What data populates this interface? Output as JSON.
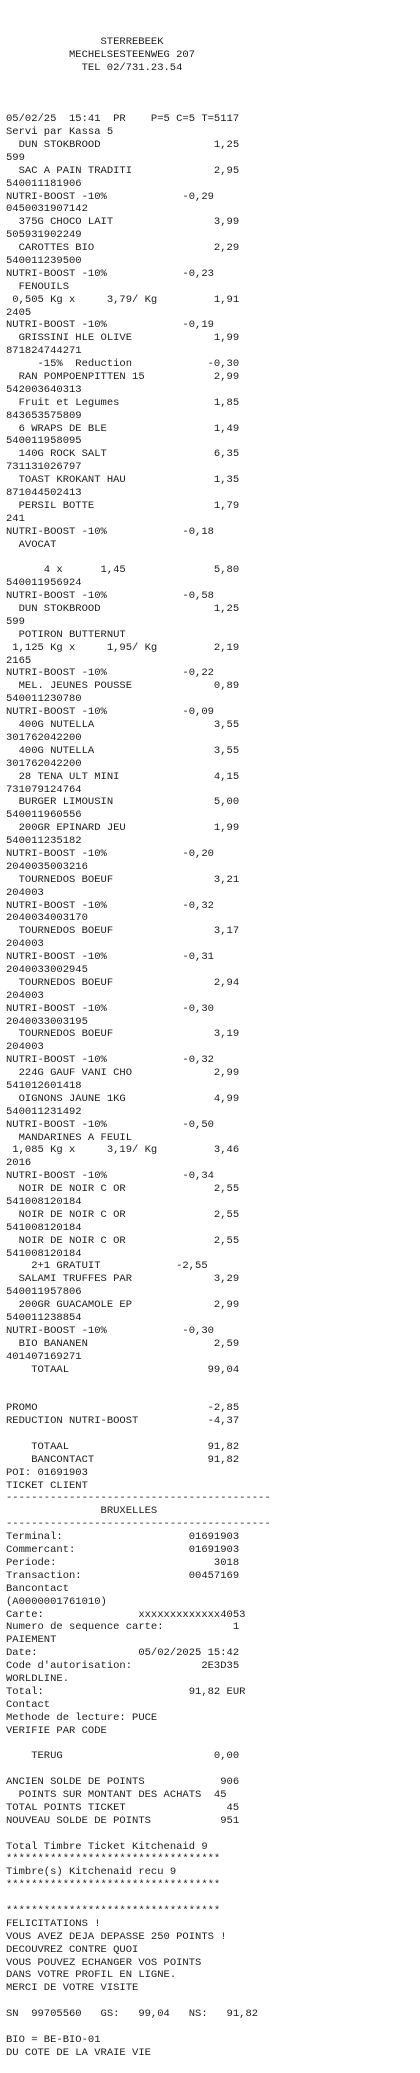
{
  "header": [
    "STERREBEEK",
    "MECHELSESTEENWEG 207",
    "TEL 02/731.23.54"
  ],
  "lines": [
    "",
    "05/02/25  15:41  PR    P=5 C=5 T=5117",
    "Servi par Kassa 5",
    "  DUN STOKBROOD                  1,25",
    "599",
    "  SAC A PAIN TRADITI             2,95",
    "540011181906",
    "NUTRI-BOOST -10%            -0,29",
    "0450031907142",
    "  375G CHOCO LAIT                3,99",
    "505931902249",
    "  CAROTTES BIO                   2,29",
    "540011239500",
    "NUTRI-BOOST -10%            -0,23",
    "  FENOUILS",
    " 0,505 Kg x     3,79/ Kg         1,91",
    "2405",
    "NUTRI-BOOST -10%            -0,19",
    "  GRISSINI HLE OLIVE             1,99",
    "871824744271",
    "     -15%  Reduction            -0,30",
    "  RAN POMPOENPITTEN 15           2,99",
    "542003640313",
    "  Fruit et Legumes               1,85",
    "843653575809",
    "  6 WRAPS DE BLE                 1,49",
    "540011958095",
    "  140G ROCK SALT                 6,35",
    "731131026797",
    "  TOAST KROKANT HAU              1,35",
    "871044502413",
    "  PERSIL BOTTE                   1,79",
    "241",
    "NUTRI-BOOST -10%            -0,18",
    "  AVOCAT",
    "",
    "      4 x      1,45              5,80",
    "540011956924",
    "NUTRI-BOOST -10%            -0,58",
    "  DUN STOKBROOD                  1,25",
    "599",
    "  POTIRON BUTTERNUT",
    " 1,125 Kg x     1,95/ Kg         2,19",
    "2165",
    "NUTRI-BOOST -10%            -0,22",
    "  MEL. JEUNES POUSSE             0,89",
    "540011230780",
    "NUTRI-BOOST -10%            -0,09",
    "  400G NUTELLA                   3,55",
    "301762042200",
    "  400G NUTELLA                   3,55",
    "301762042200",
    "  28 TENA ULT MINI               4,15",
    "731079124764",
    "  BURGER LIMOUSIN                5,00",
    "540011960556",
    "  200GR EPINARD JEU              1,99",
    "540011235182",
    "NUTRI-BOOST -10%            -0,20",
    "2040035003216",
    "  TOURNEDOS BOEUF                3,21",
    "204003",
    "NUTRI-BOOST -10%            -0,32",
    "2040034003170",
    "  TOURNEDOS BOEUF                3,17",
    "204003",
    "NUTRI-BOOST -10%            -0,31",
    "2040033002945",
    "  TOURNEDOS BOEUF                2,94",
    "204003",
    "NUTRI-BOOST -10%            -0,30",
    "2040033003195",
    "  TOURNEDOS BOEUF                3,19",
    "204003",
    "NUTRI-BOOST -10%            -0,32",
    "  224G GAUF VANI CHO             2,99",
    "541012601418",
    "  OIGNONS JAUNE 1KG              4,99",
    "540011231492",
    "NUTRI-BOOST -10%            -0,50",
    "  MANDARINES A FEUIL",
    " 1,085 Kg x     3,19/ Kg         3,46",
    "2016",
    "NUTRI-BOOST -10%            -0,34",
    "  NOIR DE NOIR C OR              2,55",
    "541008120184",
    "  NOIR DE NOIR C OR              2,55",
    "541008120184",
    "  NOIR DE NOIR C OR              2,55",
    "541008120184",
    "    2+1 GRATUIT            -2,55",
    "  SALAMI TRUFFES PAR             3,29",
    "540011957806",
    "  200GR GUACAMOLE EP             2,99",
    "540011238854",
    "NUTRI-BOOST -10%            -0,30",
    "  BIO BANANEN                    2,59",
    "401407169271",
    "    TOTAAL                      99,04",
    "",
    "",
    "PROMO                           -2,85",
    "REDUCTION NUTRI-BOOST           -4,37",
    "",
    "    TOTAAL                      91,82",
    "    BANCONTACT                  91,82",
    "POI: 01691903",
    "TICKET CLIENT",
    "------------------------------------------",
    "               BRUXELLES",
    "------------------------------------------",
    "Terminal:                    01691903",
    "Commercant:                  01691903",
    "Periode:                         3018",
    "Transaction:                 00457169",
    "Bancontact",
    "(A0000001761010)",
    "Carte:               xxxxxxxxxxxxx4053",
    "Numero de sequence carte:           1",
    "PAIEMENT",
    "Date:                05/02/2025 15:42",
    "Code d'autorisation:           2E3D35",
    "WORLDLINE.",
    "Total:                       91,82 EUR",
    "Contact",
    "Methode de lecture: PUCE",
    "VERIFIE PAR CODE",
    "",
    "    TERUG                        0,00",
    "",
    "ANCIEN SOLDE DE POINTS            906",
    "  POINTS SUR MONTANT DES ACHATS  45",
    "TOTAL POINTS TICKET                45",
    "NOUVEAU SOLDE DE POINTS           951",
    "",
    "Total Timbre Ticket Kitchenaid 9",
    "**********************************",
    "Timbre(s) Kitchenaid recu 9",
    "**********************************",
    "",
    "**********************************",
    "FELICITATIONS !",
    "VOUS AVEZ DEJA DEPASSE 250 POINTS !",
    "DECOUVREZ CONTRE QUOI",
    "VOUS POUVEZ ECHANGER VOS POINTS",
    "DANS VOTRE PROFIL EN LIGNE.",
    "MERCI DE VOTRE VISITE",
    "",
    "SN  99705560   GS:   99,04   NS:   91,82",
    "",
    "BIO = BE-BIO-01",
    "DU COTE DE LA VRAIE VIE"
  ]
}
